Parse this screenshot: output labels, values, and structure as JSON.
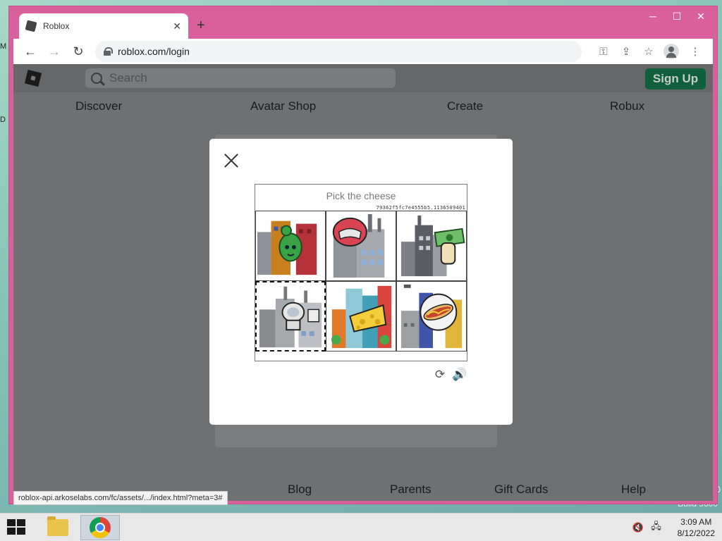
{
  "desktop": {
    "edge_letter_1": "M",
    "edge_letter_2": "D",
    "watermark_1": "0",
    "watermark_2": "Build 9600"
  },
  "browser": {
    "tab_title": "Roblox",
    "tab_close_glyph": "✕",
    "new_tab_glyph": "+",
    "url": "roblox.com/login",
    "status_url": "roblox-api.arkoselabs.com/fc/assets/.../index.html?meta=3#",
    "controls": {
      "minimize": "─",
      "maximize": "☐",
      "close": "✕"
    },
    "nav_icons": {
      "back": "←",
      "forward": "→",
      "reload": "↻"
    },
    "toolbar_icons": {
      "key": "⚿",
      "share": "⇪",
      "star": "☆",
      "menu": "⋮"
    }
  },
  "site": {
    "search_placeholder": "Search",
    "signup_label": "Sign Up",
    "nav": [
      "Discover",
      "Avatar Shop",
      "Create",
      "Robux"
    ],
    "footer": [
      "Blog",
      "Parents",
      "Gift Cards",
      "Help"
    ]
  },
  "captcha": {
    "prompt": "Pick the cheese",
    "session_id": "79362f5fc7e4555b5.1136509401",
    "tiles": [
      {
        "name": "cactus-monster-tile",
        "selected": false
      },
      {
        "name": "helmet-tile",
        "selected": false
      },
      {
        "name": "money-hand-tile",
        "selected": false
      },
      {
        "name": "toilet-tile",
        "selected": true
      },
      {
        "name": "cheese-tile",
        "selected": false
      },
      {
        "name": "hotdog-tile",
        "selected": false
      }
    ],
    "refresh_glyph": "⟳",
    "audio_glyph": "🔊"
  },
  "taskbar": {
    "time": "3:09 AM",
    "date": "8/12/2022",
    "tray_icons": [
      "speaker-muted-icon",
      "network-icon"
    ]
  },
  "colors": {
    "window_frame": "#d9609c",
    "signup_bg": "#0e5f3a"
  }
}
